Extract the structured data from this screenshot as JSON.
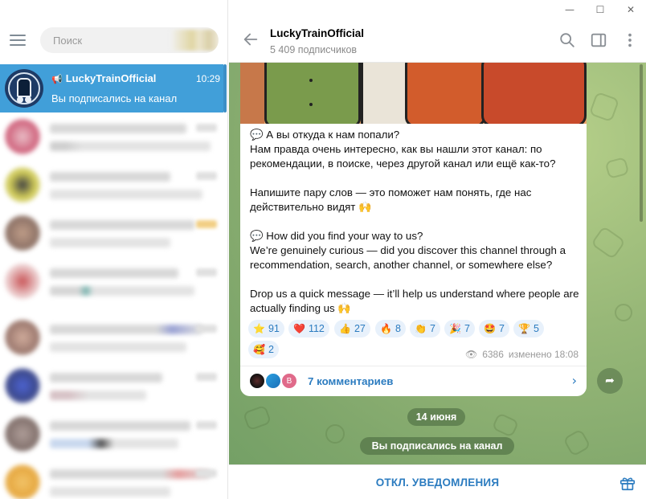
{
  "window": {
    "minimize": "—",
    "maximize": "☐",
    "close": "✕"
  },
  "left": {
    "search_placeholder": "Поиск",
    "active_chat": {
      "name": "LuckyTrainOfficial",
      "time": "10:29",
      "last_message": "Вы подписались на канал",
      "icon": "megaphone-icon"
    },
    "other_chats_blurred": 8
  },
  "header": {
    "title": "LuckyTrainOfficial",
    "subtitle": "5 409 подписчиков",
    "icons": [
      "back-arrow-icon",
      "search-icon",
      "sidebar-toggle-icon",
      "more-vertical-icon"
    ]
  },
  "post": {
    "lines_ru": [
      "💬 А вы откуда к нам попали?",
      "Нам правда очень интересно, как вы нашли этот канал: по",
      "рекомендации, в поиске, через другой канал или ещё как-то?",
      "",
      "Напишите пару слов — это поможет нам понять, где нас",
      "действительно видят 🙌"
    ],
    "lines_en": [
      "💬 How did you find your way to us?",
      "We’re genuinely curious — did you discover this channel through a",
      "recommendation, search, another channel, or somewhere else?",
      "",
      "Drop us a quick message — it’ll help us understand where people are",
      "actually finding us 🙌"
    ],
    "reactions": [
      {
        "emoji": "⭐",
        "count": "91"
      },
      {
        "emoji": "❤️",
        "count": "112"
      },
      {
        "emoji": "👍",
        "count": "27"
      },
      {
        "emoji": "🔥",
        "count": "8"
      },
      {
        "emoji": "👏",
        "count": "7"
      },
      {
        "emoji": "🎉",
        "count": "7"
      },
      {
        "emoji": "🤩",
        "count": "7"
      },
      {
        "emoji": "🏆",
        "count": "5"
      },
      {
        "emoji": "🥰",
        "count": "2"
      }
    ],
    "views": "6386",
    "edited": "изменено 18:08",
    "comments_label": "7 комментариев",
    "commenter_initial": "B"
  },
  "service": {
    "date": "14 июня",
    "joined": "Вы подписались на канал"
  },
  "bottom": {
    "mute_label": "ОТКЛ. УВЕДОМЛЕНИЯ"
  },
  "colors": {
    "accent": "#419fd9",
    "link": "#2c7cc0",
    "reaction_bg": "#e8f1fb"
  }
}
